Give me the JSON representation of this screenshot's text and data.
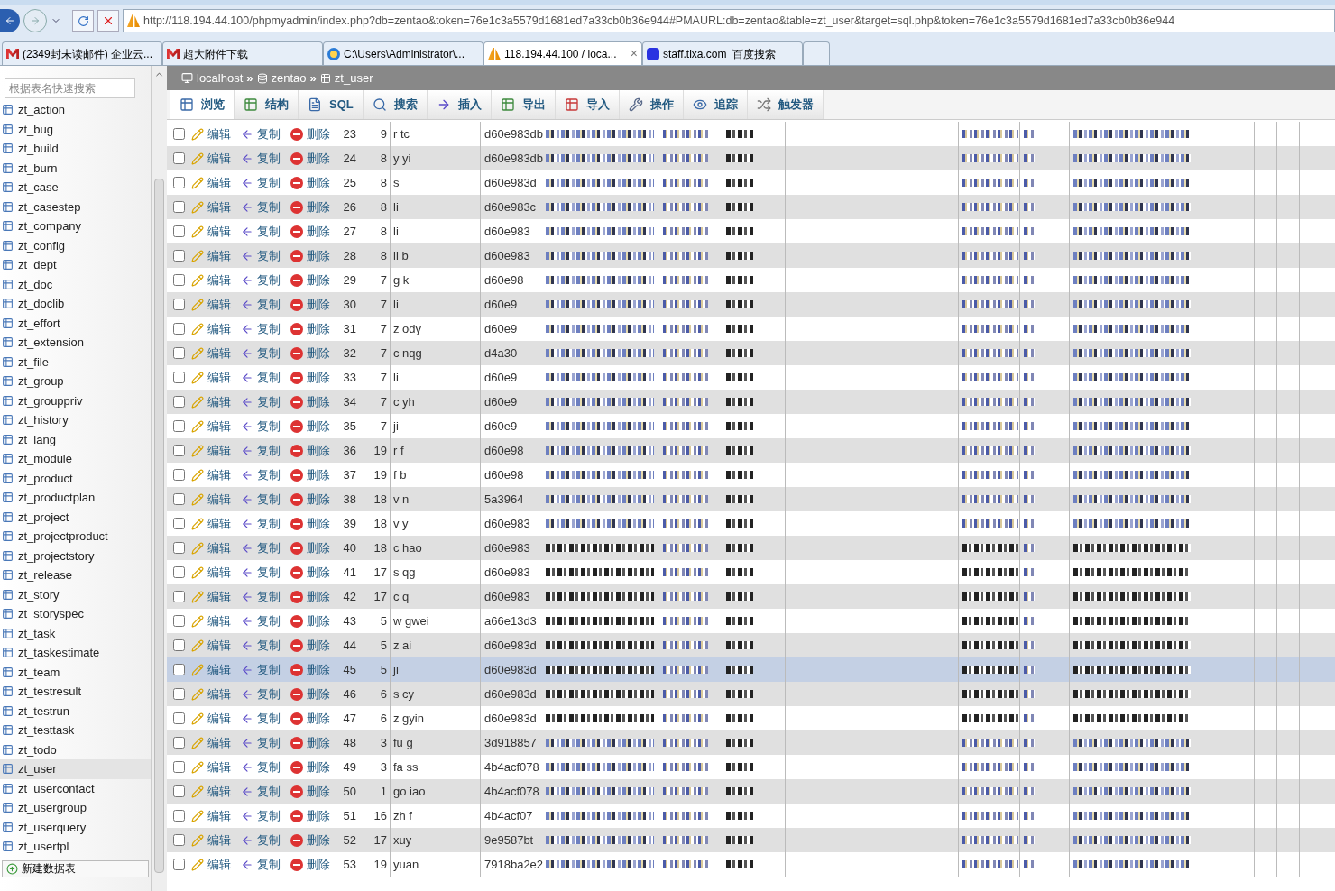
{
  "browser": {
    "url": "http://118.194.44.100/phpmyadmin/index.php?db=zentao&token=76e1c3a5579d1681ed7a33cb0b36e944#PMAURL:db=zentao&table=zt_user&target=sql.php&token=76e1c3a5579d1681ed7a33cb0b36e944",
    "tabs": [
      {
        "label": "(2349封未读邮件) 企业云...",
        "kind": "mail",
        "selected": false
      },
      {
        "label": "超大附件下载",
        "kind": "mail",
        "selected": false
      },
      {
        "label": "C:\\Users\\Administrator\\...",
        "kind": "ie",
        "selected": false
      },
      {
        "label": "118.194.44.100 / loca...",
        "kind": "pma",
        "selected": true,
        "close": "×"
      },
      {
        "label": "staff.tixa.com_百度搜索",
        "kind": "paw",
        "selected": false
      },
      {
        "kind": "blank",
        "selected": false
      }
    ]
  },
  "sidebar": {
    "search_placeholder": "根据表名快速搜索",
    "items": [
      {
        "label": "zt_action",
        "selected": false
      },
      {
        "label": "zt_bug",
        "selected": false
      },
      {
        "label": "zt_build",
        "selected": false
      },
      {
        "label": "zt_burn",
        "selected": false
      },
      {
        "label": "zt_case",
        "selected": false
      },
      {
        "label": "zt_casestep",
        "selected": false
      },
      {
        "label": "zt_company",
        "selected": false
      },
      {
        "label": "zt_config",
        "selected": false
      },
      {
        "label": "zt_dept",
        "selected": false
      },
      {
        "label": "zt_doc",
        "selected": false
      },
      {
        "label": "zt_doclib",
        "selected": false
      },
      {
        "label": "zt_effort",
        "selected": false
      },
      {
        "label": "zt_extension",
        "selected": false
      },
      {
        "label": "zt_file",
        "selected": false
      },
      {
        "label": "zt_group",
        "selected": false
      },
      {
        "label": "zt_grouppriv",
        "selected": false
      },
      {
        "label": "zt_history",
        "selected": false
      },
      {
        "label": "zt_lang",
        "selected": false
      },
      {
        "label": "zt_module",
        "selected": false
      },
      {
        "label": "zt_product",
        "selected": false
      },
      {
        "label": "zt_productplan",
        "selected": false
      },
      {
        "label": "zt_project",
        "selected": false
      },
      {
        "label": "zt_projectproduct",
        "selected": false
      },
      {
        "label": "zt_projectstory",
        "selected": false
      },
      {
        "label": "zt_release",
        "selected": false
      },
      {
        "label": "zt_story",
        "selected": false
      },
      {
        "label": "zt_storyspec",
        "selected": false
      },
      {
        "label": "zt_task",
        "selected": false
      },
      {
        "label": "zt_taskestimate",
        "selected": false
      },
      {
        "label": "zt_team",
        "selected": false
      },
      {
        "label": "zt_testresult",
        "selected": false
      },
      {
        "label": "zt_testrun",
        "selected": false
      },
      {
        "label": "zt_testtask",
        "selected": false
      },
      {
        "label": "zt_todo",
        "selected": false
      },
      {
        "label": "zt_user",
        "selected": true
      },
      {
        "label": "zt_usercontact",
        "selected": false
      },
      {
        "label": "zt_usergroup",
        "selected": false
      },
      {
        "label": "zt_userquery",
        "selected": false
      },
      {
        "label": "zt_usertpl",
        "selected": false
      }
    ],
    "new_table": "新建数据表"
  },
  "breadcrumb": [
    {
      "label": "localhost"
    },
    {
      "separator": "»",
      "label": "zentao"
    },
    {
      "separator": "»",
      "label": "zt_user"
    }
  ],
  "toolbar": [
    {
      "label": "浏览",
      "kind": "browse",
      "selected": true
    },
    {
      "label": "结构",
      "kind": "structure",
      "selected": false
    },
    {
      "label": "SQL",
      "kind": "sql",
      "selected": false
    },
    {
      "label": "搜索",
      "kind": "search",
      "selected": false
    },
    {
      "label": "插入",
      "kind": "insert",
      "selected": false
    },
    {
      "label": "导出",
      "kind": "export",
      "selected": false
    },
    {
      "label": "导入",
      "kind": "import",
      "selected": false
    },
    {
      "label": "操作",
      "kind": "operate",
      "selected": false
    },
    {
      "label": "追踪",
      "kind": "track",
      "selected": false
    },
    {
      "label": "触发器",
      "kind": "trigger",
      "selected": false
    }
  ],
  "rows": [
    {
      "checked": false,
      "actions": [
        "编辑",
        "复制",
        "删除"
      ],
      "id": "23",
      "dept": "9",
      "account": "r tc",
      "password": "d60e983db",
      "highlighted": false
    },
    {
      "checked": false,
      "actions": [
        "编辑",
        "复制",
        "删除"
      ],
      "id": "24",
      "dept": "8",
      "account": "y yi",
      "password": "d60e983db",
      "highlighted": false
    },
    {
      "checked": false,
      "actions": [
        "编辑",
        "复制",
        "删除"
      ],
      "id": "25",
      "dept": "8",
      "account": "s",
      "password": "d60e983d",
      "highlighted": false
    },
    {
      "checked": false,
      "actions": [
        "编辑",
        "复制",
        "删除"
      ],
      "id": "26",
      "dept": "8",
      "account": "li",
      "password": "d60e983c",
      "highlighted": false
    },
    {
      "checked": false,
      "actions": [
        "编辑",
        "复制",
        "删除"
      ],
      "id": "27",
      "dept": "8",
      "account": "li",
      "password": "d60e983",
      "highlighted": false
    },
    {
      "checked": false,
      "actions": [
        "编辑",
        "复制",
        "删除"
      ],
      "id": "28",
      "dept": "8",
      "account": "li b",
      "password": "d60e983",
      "highlighted": false
    },
    {
      "checked": false,
      "actions": [
        "编辑",
        "复制",
        "删除"
      ],
      "id": "29",
      "dept": "7",
      "account": "g k",
      "password": "d60e98",
      "highlighted": false
    },
    {
      "checked": false,
      "actions": [
        "编辑",
        "复制",
        "删除"
      ],
      "id": "30",
      "dept": "7",
      "account": "li",
      "password": "d60e9",
      "highlighted": false
    },
    {
      "checked": false,
      "actions": [
        "编辑",
        "复制",
        "删除"
      ],
      "id": "31",
      "dept": "7",
      "account": "z ody",
      "password": "d60e9",
      "highlighted": false
    },
    {
      "checked": false,
      "actions": [
        "编辑",
        "复制",
        "删除"
      ],
      "id": "32",
      "dept": "7",
      "account": "c nqg",
      "password": "d4a30",
      "highlighted": false
    },
    {
      "checked": false,
      "actions": [
        "编辑",
        "复制",
        "删除"
      ],
      "id": "33",
      "dept": "7",
      "account": "li",
      "password": "d60e9",
      "highlighted": false
    },
    {
      "checked": false,
      "actions": [
        "编辑",
        "复制",
        "删除"
      ],
      "id": "34",
      "dept": "7",
      "account": "c yh",
      "password": "d60e9",
      "highlighted": false
    },
    {
      "checked": false,
      "actions": [
        "编辑",
        "复制",
        "删除"
      ],
      "id": "35",
      "dept": "7",
      "account": "ji",
      "password": "d60e9",
      "highlighted": false
    },
    {
      "checked": false,
      "actions": [
        "编辑",
        "复制",
        "删除"
      ],
      "id": "36",
      "dept": "19",
      "account": "r f",
      "password": "d60e98",
      "highlighted": false
    },
    {
      "checked": false,
      "actions": [
        "编辑",
        "复制",
        "删除"
      ],
      "id": "37",
      "dept": "19",
      "account": "f b",
      "password": "d60e98",
      "highlighted": false
    },
    {
      "checked": false,
      "actions": [
        "编辑",
        "复制",
        "删除"
      ],
      "id": "38",
      "dept": "18",
      "account": "v n",
      "password": "5a3964",
      "highlighted": false
    },
    {
      "checked": false,
      "actions": [
        "编辑",
        "复制",
        "删除"
      ],
      "id": "39",
      "dept": "18",
      "account": "v y",
      "password": "d60e983",
      "highlighted": false
    },
    {
      "checked": false,
      "actions": [
        "编辑",
        "复制",
        "删除"
      ],
      "id": "40",
      "dept": "18",
      "account": "c hao",
      "password": "d60e983",
      "highlighted": false
    },
    {
      "checked": false,
      "actions": [
        "编辑",
        "复制",
        "删除"
      ],
      "id": "41",
      "dept": "17",
      "account": "s qg",
      "password": "d60e983",
      "highlighted": false
    },
    {
      "checked": false,
      "actions": [
        "编辑",
        "复制",
        "删除"
      ],
      "id": "42",
      "dept": "17",
      "account": "c q",
      "password": "d60e983",
      "highlighted": false
    },
    {
      "checked": false,
      "actions": [
        "编辑",
        "复制",
        "删除"
      ],
      "id": "43",
      "dept": "5",
      "account": "w gwei",
      "password": "a66e13d3",
      "highlighted": false
    },
    {
      "checked": false,
      "actions": [
        "编辑",
        "复制",
        "删除"
      ],
      "id": "44",
      "dept": "5",
      "account": "z ai",
      "password": "d60e983d",
      "highlighted": false
    },
    {
      "checked": false,
      "actions": [
        "编辑",
        "复制",
        "删除"
      ],
      "id": "45",
      "dept": "5",
      "account": "ji",
      "password": "d60e983d",
      "highlighted": true
    },
    {
      "checked": false,
      "actions": [
        "编辑",
        "复制",
        "删除"
      ],
      "id": "46",
      "dept": "6",
      "account": "s cy",
      "password": "d60e983d",
      "highlighted": false
    },
    {
      "checked": false,
      "actions": [
        "编辑",
        "复制",
        "删除"
      ],
      "id": "47",
      "dept": "6",
      "account": "z gyin",
      "password": "d60e983d",
      "highlighted": false
    },
    {
      "checked": false,
      "actions": [
        "编辑",
        "复制",
        "删除"
      ],
      "id": "48",
      "dept": "3",
      "account": "fu g",
      "password": "3d918857",
      "highlighted": false
    },
    {
      "checked": false,
      "actions": [
        "编辑",
        "复制",
        "删除"
      ],
      "id": "49",
      "dept": "3",
      "account": "fa ss",
      "password": "4b4acf078",
      "highlighted": false
    },
    {
      "checked": false,
      "actions": [
        "编辑",
        "复制",
        "删除"
      ],
      "id": "50",
      "dept": "1",
      "account": "go iao",
      "password": "4b4acf078",
      "highlighted": false
    },
    {
      "checked": false,
      "actions": [
        "编辑",
        "复制",
        "删除"
      ],
      "id": "51",
      "dept": "16",
      "account": "zh f",
      "password": "4b4acf07",
      "highlighted": false
    },
    {
      "checked": false,
      "actions": [
        "编辑",
        "复制",
        "删除"
      ],
      "id": "52",
      "dept": "17",
      "account": "xuy",
      "password": "9e9587bt",
      "highlighted": false
    },
    {
      "checked": false,
      "actions": [
        "编辑",
        "复制",
        "删除"
      ],
      "id": "53",
      "dept": "19",
      "account": "yuan",
      "password": "7918ba2e2",
      "highlighted": false
    }
  ]
}
